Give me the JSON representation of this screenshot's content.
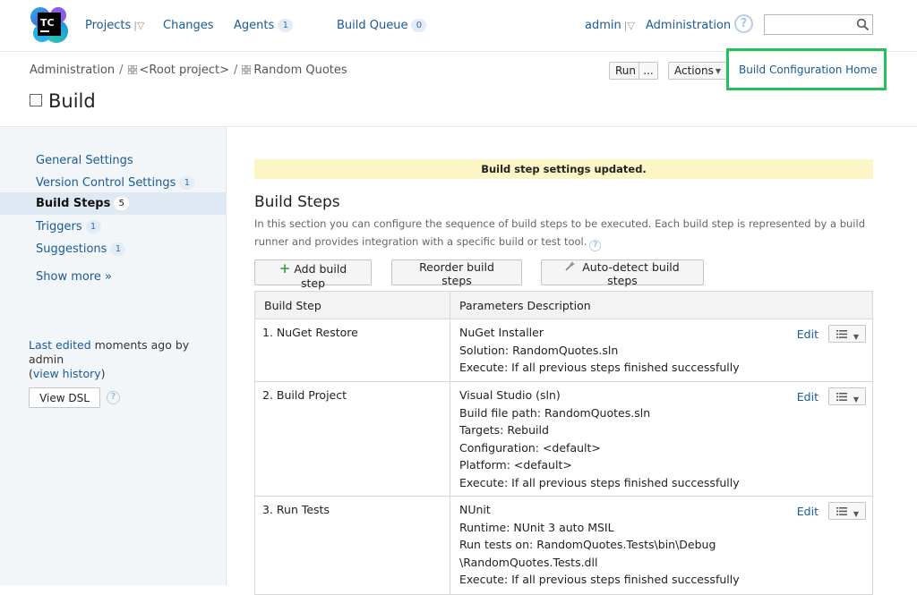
{
  "nav": {
    "logo_text": "TC",
    "projects": "Projects",
    "changes": "Changes",
    "agents": "Agents",
    "agents_count": "1",
    "build_queue": "Build Queue",
    "build_queue_count": "0",
    "user": "admin",
    "administration": "Administration",
    "help": "?",
    "search_value": ""
  },
  "breadcrumb": {
    "items": [
      "Administration",
      "<Root project>",
      "Random Quotes"
    ],
    "separator": "/"
  },
  "header": {
    "title": "Build",
    "run": "Run",
    "run_more": "...",
    "actions": "Actions",
    "home_link": "Build Configuration Home"
  },
  "sidebar": {
    "items": [
      {
        "label": "General Settings",
        "count": ""
      },
      {
        "label": "Version Control Settings",
        "count": "1"
      },
      {
        "label": "Build Steps",
        "count": "5"
      },
      {
        "label": "Triggers",
        "count": "1"
      },
      {
        "label": "Suggestions",
        "count": "1"
      }
    ],
    "show_more": "Show more »",
    "last_edited_link": "Last edited",
    "last_edited_text": "moments ago by admin",
    "view_history_open": "(",
    "view_history": "view history",
    "view_history_close": ")",
    "view_dsl": "View DSL",
    "dsl_help": "?"
  },
  "main": {
    "notice": "Build step settings updated.",
    "title": "Build Steps",
    "description": "In this section you can configure the sequence of build steps to be executed. Each build step is represented by a build runner and provides integration with a specific build or test tool.",
    "help": "?",
    "add_step": "Add build step",
    "add_icon": "+",
    "reorder": "Reorder build steps",
    "autodetect": "Auto-detect build steps",
    "columns": [
      "Build Step",
      "Parameters Description"
    ],
    "edit_label": "Edit",
    "steps": [
      {
        "name": "1. NuGet Restore",
        "params": [
          "NuGet Installer",
          "Solution: RandomQuotes.sln",
          "Execute: If all previous steps finished successfully"
        ]
      },
      {
        "name": "2. Build Project",
        "params": [
          "Visual Studio (sln)",
          "Build file path: RandomQuotes.sln",
          "Targets: Rebuild",
          "Configuration: <default>",
          "Platform: <default>",
          "Execute: If all previous steps finished successfully"
        ]
      },
      {
        "name": "3. Run Tests",
        "params": [
          "NUnit",
          "Runtime: NUnit 3 auto MSIL",
          "Run tests on: RandomQuotes.Tests\\bin\\Debug",
          "\\RandomQuotes.Tests.dll",
          "Execute: If all previous steps finished successfully"
        ]
      }
    ]
  },
  "colors": {
    "link": "#1a5a96",
    "highlight_border": "#22c15a",
    "notice_bg": "#fcf6c7",
    "sidebar_bg": "#f3f6f9",
    "sidebar_active_bg": "#dfe9f3"
  }
}
